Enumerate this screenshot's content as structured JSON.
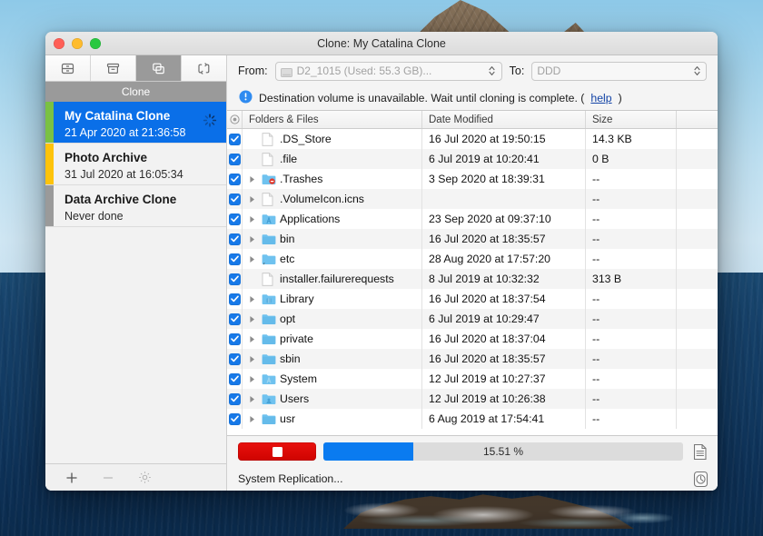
{
  "window": {
    "title": "Clone: My Catalina Clone",
    "traffic_lights": [
      "close-button",
      "minimize-button",
      "zoom-button"
    ]
  },
  "toolbar": {
    "segments": [
      {
        "name": "backup",
        "icon": "drawer-icon",
        "active": false
      },
      {
        "name": "archive",
        "icon": "archive-box-icon",
        "active": false
      },
      {
        "name": "clone",
        "icon": "clone-icon",
        "active": true
      },
      {
        "name": "sync",
        "icon": "sync-icon",
        "active": false
      }
    ],
    "active_label": "Clone"
  },
  "sidebar": {
    "tasks": [
      {
        "name": "My Catalina Clone",
        "date": "21 Apr 2020 at 21:36:58",
        "strip_color": "#7ac143",
        "selected": true,
        "busy": true
      },
      {
        "name": "Photo Archive",
        "date": "31 Jul 2020 at 16:05:34",
        "strip_color": "#fdc30b",
        "selected": false,
        "busy": false
      },
      {
        "name": "Data Archive Clone",
        "date": "Never done",
        "strip_color": "#9a9a9a",
        "selected": false,
        "busy": false
      }
    ],
    "footer_buttons": [
      {
        "name": "add-task-button",
        "icon": "plus-icon",
        "enabled": true
      },
      {
        "name": "remove-task-button",
        "icon": "minus-icon",
        "enabled": false
      },
      {
        "name": "task-settings-button",
        "icon": "gear-icon",
        "enabled": true
      }
    ]
  },
  "source_dest": {
    "from_label": "From:",
    "from_value": "D2_1015 (Used: 55.3 GB)...",
    "to_label": "To:",
    "to_value": "DDD"
  },
  "notice": {
    "icon": "info-circle-icon",
    "text": "Destination volume is unavailable. Wait until cloning is complete. (",
    "link": "help",
    "text_end": ")"
  },
  "table": {
    "headers": {
      "select_all": "select-all-radio",
      "name": "Folders & Files",
      "date": "Date Modified",
      "size": "Size"
    },
    "rows": [
      {
        "checked": true,
        "expandable": false,
        "icon": "file-icon",
        "name": ".DS_Store",
        "date": "16 Jul 2020 at 19:50:15",
        "size": "14.3 KB"
      },
      {
        "checked": true,
        "expandable": false,
        "icon": "file-icon",
        "name": ".file",
        "date": "6 Jul 2019 at 10:20:41",
        "size": "0 B"
      },
      {
        "checked": true,
        "expandable": true,
        "icon": "trash-folder-icon",
        "name": ".Trashes",
        "date": "3 Sep 2020 at 18:39:31",
        "size": "--"
      },
      {
        "checked": true,
        "expandable": true,
        "icon": "file-icon",
        "name": ".VolumeIcon.icns",
        "date": "",
        "size": "--"
      },
      {
        "checked": true,
        "expandable": true,
        "icon": "applications-folder-icon",
        "name": "Applications",
        "date": "23 Sep 2020 at 09:37:10",
        "size": "--"
      },
      {
        "checked": true,
        "expandable": true,
        "icon": "folder-icon",
        "name": "bin",
        "date": "16 Jul 2020 at 18:35:57",
        "size": "--"
      },
      {
        "checked": true,
        "expandable": true,
        "icon": "alias-folder-icon",
        "name": "etc",
        "date": "28 Aug 2020 at 17:57:20",
        "size": "--"
      },
      {
        "checked": true,
        "expandable": false,
        "icon": "file-icon",
        "name": "installer.failurerequests",
        "date": "8 Jul 2019 at 10:32:32",
        "size": "313 B"
      },
      {
        "checked": true,
        "expandable": true,
        "icon": "library-folder-icon",
        "name": "Library",
        "date": "16 Jul 2020 at 18:37:54",
        "size": "--"
      },
      {
        "checked": true,
        "expandable": true,
        "icon": "folder-icon",
        "name": "opt",
        "date": "6 Jul 2019 at 10:29:47",
        "size": "--"
      },
      {
        "checked": true,
        "expandable": true,
        "icon": "folder-icon",
        "name": "private",
        "date": "16 Jul 2020 at 18:37:04",
        "size": "--"
      },
      {
        "checked": true,
        "expandable": true,
        "icon": "folder-icon",
        "name": "sbin",
        "date": "16 Jul 2020 at 18:35:57",
        "size": "--"
      },
      {
        "checked": true,
        "expandable": true,
        "icon": "system-folder-icon",
        "name": "System",
        "date": "12 Jul 2019 at 10:27:37",
        "size": "--"
      },
      {
        "checked": true,
        "expandable": true,
        "icon": "users-folder-icon",
        "name": "Users",
        "date": "12 Jul 2019 at 10:26:38",
        "size": "--"
      },
      {
        "checked": true,
        "expandable": true,
        "icon": "folder-icon",
        "name": "usr",
        "date": "6 Aug 2019 at 17:54:41",
        "size": "--"
      }
    ]
  },
  "progress": {
    "stop_button": "stop-button",
    "percent_label": "15.51 %",
    "percent_value": 15.51,
    "bar_fill_fraction": 0.25,
    "status": "System Replication...",
    "log_button": "log-icon",
    "history_button": "history-clock-icon"
  },
  "colors": {
    "accent_blue": "#0a6fe8",
    "progress_blue": "#0a7bf0",
    "stop_red": "#d60a06",
    "strip_green": "#7ac143",
    "strip_yellow": "#fdc30b",
    "strip_gray": "#9a9a9a",
    "folder_blue": "#6fc2ef"
  }
}
